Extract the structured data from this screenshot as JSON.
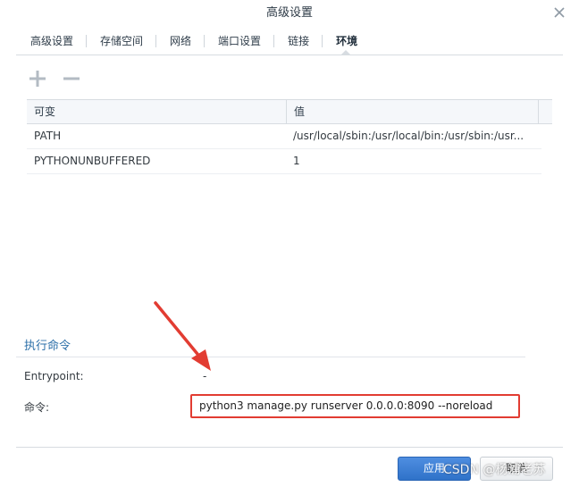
{
  "window": {
    "title": "高级设置"
  },
  "tabs": [
    {
      "label": "高级设置"
    },
    {
      "label": "存储空间"
    },
    {
      "label": "网络"
    },
    {
      "label": "端口设置"
    },
    {
      "label": "链接"
    },
    {
      "label": "环境"
    }
  ],
  "active_tab": "环境",
  "env_table": {
    "headers": {
      "name": "可变",
      "value": "值"
    },
    "rows": [
      {
        "name": "PATH",
        "value": "/usr/local/sbin:/usr/local/bin:/usr/sbin:/usr..."
      },
      {
        "name": "PYTHONUNBUFFERED",
        "value": "1"
      }
    ]
  },
  "exec": {
    "section_title": "执行命令",
    "entrypoint_label": "Entrypoint:",
    "entrypoint_value": "-",
    "command_label": "命令:",
    "command_value": "python3 manage.py runserver 0.0.0.0:8090 --noreload"
  },
  "buttons": {
    "apply": "应用",
    "cancel": "取消"
  },
  "watermark": "CSDN @杨浦老苏",
  "colors": {
    "accent": "#2c6fa8",
    "primary_button": "#3a7fd8",
    "highlight": "#e23c32"
  },
  "icons": {
    "close": "close-icon",
    "add": "plus-icon",
    "remove": "minus-icon",
    "annotation": "red-arrow"
  }
}
